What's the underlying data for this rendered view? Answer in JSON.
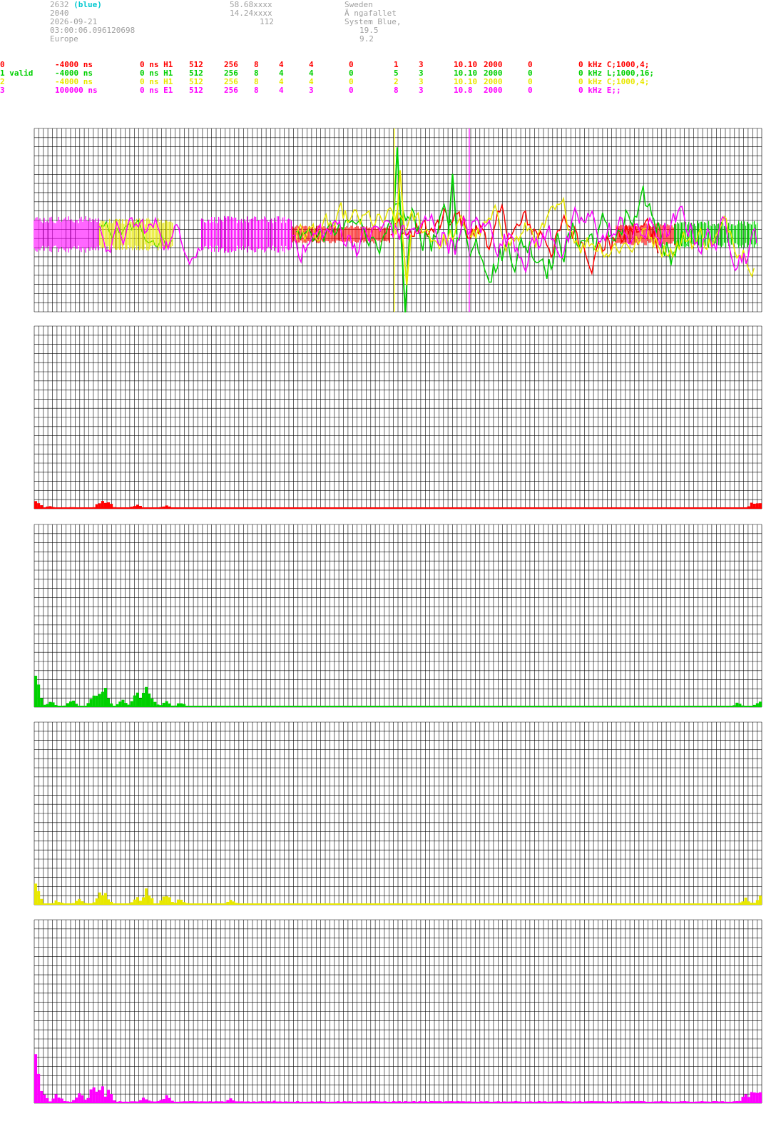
{
  "station": {
    "id": "2632",
    "tag": "(blue)",
    "number": "2040",
    "date": "2026-09-21",
    "time": "03:00:06.096120698",
    "region": "Europe",
    "lat": "58.68xxxx",
    "lon": "14.24xxxx",
    "alt": "112",
    "country": "Sweden",
    "place": "Ä ngafallet",
    "system": "System Blue,",
    "val1": "19.5",
    "val2": "9.2"
  },
  "channels": [
    {
      "color": "#ff0000",
      "cells": [
        "0",
        "-4000 ns",
        "0 ns H1",
        "512",
        "256",
        "8",
        "4",
        "4",
        "0",
        "1",
        "3",
        "10.10",
        "2000",
        "0",
        "0 kHz C;1000,4;"
      ]
    },
    {
      "color": "#00d000",
      "cells": [
        "1 valid",
        "-4000 ns",
        "0 ns H1",
        "512",
        "256",
        "8",
        "4",
        "4",
        "0",
        "5",
        "3",
        "10.10",
        "2000",
        "0",
        "0 kHz L;1000,16;"
      ]
    },
    {
      "color": "#e8e800",
      "cells": [
        "2",
        "-4000 ns",
        "0 ns H1",
        "512",
        "256",
        "8",
        "4",
        "4",
        "0",
        "2",
        "3",
        "10.10",
        "2000",
        "0",
        "0 kHz C;1000,4;"
      ]
    },
    {
      "color": "#ff00ff",
      "cells": [
        "3",
        "100000 ns",
        "0 ns E1",
        "512",
        "256",
        "8",
        "4",
        "3",
        "0",
        "8",
        "3",
        "10.8",
        "2000",
        "0",
        "0 kHz E;;"
      ]
    }
  ],
  "colors": {
    "grid": "#000000",
    "red": "#ff0000",
    "green": "#00d000",
    "yellow": "#e8e800",
    "magenta": "#ff00ff",
    "marker_yellow": "#ffff00",
    "marker_magenta": "#ff00ff"
  },
  "chart_data": [
    {
      "type": "line",
      "series": [
        {
          "color": "#ff0000",
          "segments": [
            {
              "x0": 0.355,
              "x1": 0.49,
              "kind": "burst",
              "amp": 0.1
            },
            {
              "x0": 0.49,
              "x1": 0.86,
              "kind": "wave",
              "amp": 0.3
            },
            {
              "x0": 0.8,
              "x1": 0.88,
              "kind": "burst",
              "amp": 0.12
            },
            {
              "x0": 0.88,
              "x1": 0.89,
              "kind": "burst",
              "amp": 0.12
            }
          ]
        },
        {
          "color": "#00d000",
          "segments": [
            {
              "x0": 0.09,
              "x1": 0.19,
              "kind": "wave",
              "amp": 0.15
            },
            {
              "x0": 0.36,
              "x1": 0.49,
              "kind": "wave",
              "amp": 0.2
            },
            {
              "x0": 0.49,
              "x1": 0.9,
              "kind": "wave",
              "amp": 0.35
            },
            {
              "x0": 0.88,
              "x1": 0.995,
              "kind": "burst",
              "amp": 0.15
            }
          ],
          "spikes": [
            {
              "x": 0.499,
              "v": 0.95
            },
            {
              "x": 0.51,
              "v": -0.85
            },
            {
              "x": 0.575,
              "v": 0.66
            }
          ]
        },
        {
          "color": "#e8e800",
          "segments": [
            {
              "x0": 0.09,
              "x1": 0.19,
              "kind": "burst",
              "amp": 0.18
            },
            {
              "x0": 0.36,
              "x1": 0.99,
              "kind": "wave",
              "amp": 0.25
            }
          ],
          "spikes": [
            {
              "x": 0.503,
              "v": 0.7
            },
            {
              "x": 0.512,
              "v": -0.55
            }
          ]
        },
        {
          "color": "#ff00ff",
          "segments": [
            {
              "x0": 0.0,
              "x1": 0.09,
              "kind": "burst",
              "amp": 0.2
            },
            {
              "x0": 0.09,
              "x1": 0.23,
              "kind": "wave",
              "amp": 0.25
            },
            {
              "x0": 0.23,
              "x1": 0.355,
              "kind": "burst",
              "amp": 0.2
            },
            {
              "x0": 0.355,
              "x1": 0.995,
              "kind": "wave",
              "amp": 0.3
            }
          ]
        }
      ],
      "markers": [
        {
          "x": 0.495,
          "color": "#ffff00"
        },
        {
          "x": 0.598,
          "color": "#ff00ff"
        }
      ]
    },
    {
      "type": "bar",
      "color": "#ff0000",
      "bins": 250,
      "peaks": [
        [
          0.0,
          0.06
        ],
        [
          0.02,
          0.02
        ],
        [
          0.05,
          0.015
        ],
        [
          0.09,
          0.055
        ],
        [
          0.1,
          0.05
        ],
        [
          0.14,
          0.03
        ],
        [
          0.18,
          0.025
        ],
        [
          0.3,
          0.01
        ],
        [
          0.99,
          0.04
        ],
        [
          1.0,
          0.05
        ]
      ],
      "floor": 0.008
    },
    {
      "type": "bar",
      "color": "#00d000",
      "bins": 250,
      "peaks": [
        [
          0.0,
          0.2
        ],
        [
          0.02,
          0.04
        ],
        [
          0.05,
          0.06
        ],
        [
          0.08,
          0.07
        ],
        [
          0.09,
          0.13
        ],
        [
          0.095,
          0.12
        ],
        [
          0.12,
          0.05
        ],
        [
          0.14,
          0.09
        ],
        [
          0.153,
          0.14
        ],
        [
          0.16,
          0.06
        ],
        [
          0.18,
          0.04
        ],
        [
          0.2,
          0.03
        ],
        [
          0.97,
          0.03
        ],
        [
          1.0,
          0.05
        ]
      ],
      "floor": 0.008
    },
    {
      "type": "bar",
      "color": "#e8e800",
      "bins": 250,
      "peaks": [
        [
          0.0,
          0.12
        ],
        [
          0.03,
          0.03
        ],
        [
          0.06,
          0.035
        ],
        [
          0.09,
          0.08
        ],
        [
          0.095,
          0.075
        ],
        [
          0.14,
          0.05
        ],
        [
          0.153,
          0.1
        ],
        [
          0.18,
          0.07
        ],
        [
          0.2,
          0.04
        ],
        [
          0.27,
          0.03
        ],
        [
          0.98,
          0.04
        ],
        [
          1.0,
          0.05
        ]
      ],
      "floor": 0.006
    },
    {
      "type": "bar",
      "color": "#ff00ff",
      "bins": 250,
      "peaks": [
        [
          0.0,
          0.28
        ],
        [
          0.01,
          0.08
        ],
        [
          0.03,
          0.06
        ],
        [
          0.06,
          0.07
        ],
        [
          0.08,
          0.12
        ],
        [
          0.09,
          0.12
        ],
        [
          0.1,
          0.08
        ],
        [
          0.15,
          0.04
        ],
        [
          0.18,
          0.05
        ],
        [
          0.27,
          0.03
        ],
        [
          0.33,
          0.02
        ],
        [
          0.98,
          0.06
        ],
        [
          0.99,
          0.1
        ],
        [
          1.0,
          0.09
        ]
      ],
      "floor": 0.012
    }
  ]
}
